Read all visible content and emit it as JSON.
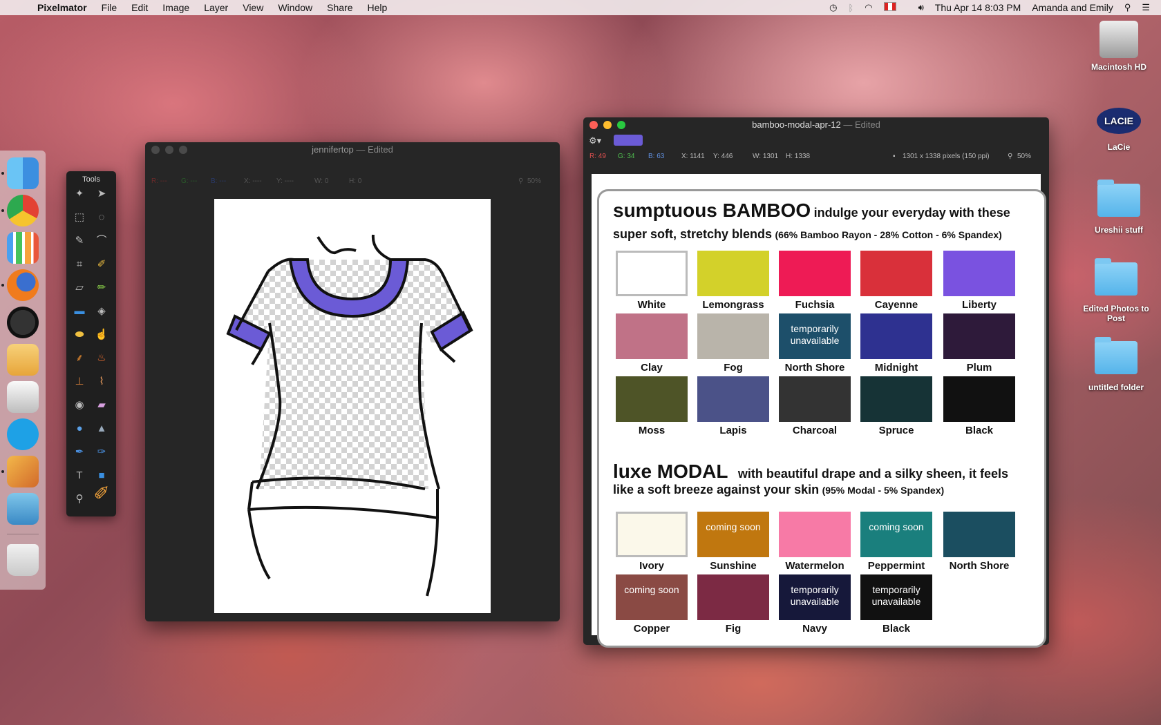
{
  "menubar": {
    "app_name": "Pixelmator",
    "items": [
      "File",
      "Edit",
      "Image",
      "Layer",
      "View",
      "Window",
      "Share",
      "Help"
    ],
    "clock": "Thu Apr 14  8:03 PM",
    "user": "Amanda and Emily"
  },
  "tools_palette": {
    "title": "Tools"
  },
  "window_left": {
    "title": "jennifertop",
    "edited": "— Edited",
    "info": {
      "r": "R: ---",
      "g": "G: ---",
      "b": "B: ---",
      "x": "X: ----",
      "y": "Y: ----",
      "w": "W: 0",
      "h": "H: 0",
      "zoom": "50%"
    }
  },
  "window_right": {
    "title": "bamboo-modal-apr-12",
    "edited": "— Edited",
    "swatch_color": "#6b5bd6",
    "info": {
      "r": "R: 49",
      "g": "G: 34",
      "b": "B: 63",
      "x": "X: 1141",
      "y": "Y: 446",
      "w": "W: 1301",
      "h": "H: 1338",
      "dims": "1301 x 1338 pixels (150 ppi)",
      "zoom": "50%"
    },
    "bamboo": {
      "title_big": "sumptuous BAMBOO",
      "title_rest": "indulge your everyday with these",
      "line2": "super soft, stretchy blends",
      "line2_small": "(66% Bamboo Rayon - 28% Cotton - 6% Spandex)",
      "swatches": [
        {
          "label": "White",
          "color": "#ffffff",
          "note": ""
        },
        {
          "label": "Lemongrass",
          "color": "#d3d12a",
          "note": ""
        },
        {
          "label": "Fuchsia",
          "color": "#ee1b55",
          "note": ""
        },
        {
          "label": "Cayenne",
          "color": "#d9303a",
          "note": ""
        },
        {
          "label": "Liberty",
          "color": "#7a52e0",
          "note": ""
        },
        {
          "label": "Clay",
          "color": "#c07287",
          "note": ""
        },
        {
          "label": "Fog",
          "color": "#b9b4aa",
          "note": ""
        },
        {
          "label": "North Shore",
          "color": "#1d4f6a",
          "note": "temporarily unavailable"
        },
        {
          "label": "Midnight",
          "color": "#2e3190",
          "note": ""
        },
        {
          "label": "Plum",
          "color": "#2e1a3a",
          "note": ""
        },
        {
          "label": "Moss",
          "color": "#4e5427",
          "note": ""
        },
        {
          "label": "Lapis",
          "color": "#4b5288",
          "note": ""
        },
        {
          "label": "Charcoal",
          "color": "#333333",
          "note": ""
        },
        {
          "label": "Spruce",
          "color": "#163336",
          "note": ""
        },
        {
          "label": "Black",
          "color": "#111111",
          "note": ""
        }
      ]
    },
    "modal": {
      "title_big": "luxe MODAL",
      "title_rest": "with beautiful drape and a silky sheen, it feels",
      "line2": "like a soft breeze against your skin",
      "line2_small": "(95% Modal - 5% Spandex)",
      "swatches": [
        {
          "label": "Ivory",
          "color": "#fbf8ea",
          "note": ""
        },
        {
          "label": "Sunshine",
          "color": "#c0770f",
          "note": "coming soon"
        },
        {
          "label": "Watermelon",
          "color": "#f77aa6",
          "note": ""
        },
        {
          "label": "Peppermint",
          "color": "#1a7f7d",
          "note": "coming soon"
        },
        {
          "label": "North Shore",
          "color": "#1b4e60",
          "note": ""
        },
        {
          "label": "Copper",
          "color": "#8a4a44",
          "note": "coming soon"
        },
        {
          "label": "Fig",
          "color": "#7c2a44",
          "note": ""
        },
        {
          "label": "Navy",
          "color": "#16183a",
          "note": "temporarily unavailable"
        },
        {
          "label": "Black",
          "color": "#111111",
          "note": "temporarily unavailable"
        }
      ]
    }
  },
  "desktop_icons": [
    {
      "label": "Macintosh HD"
    },
    {
      "label": "LaCie",
      "badge": "LACIE"
    },
    {
      "label": "Ureshii stuff"
    },
    {
      "label": "Edited Photos to Post"
    },
    {
      "label": "untitled folder"
    }
  ]
}
